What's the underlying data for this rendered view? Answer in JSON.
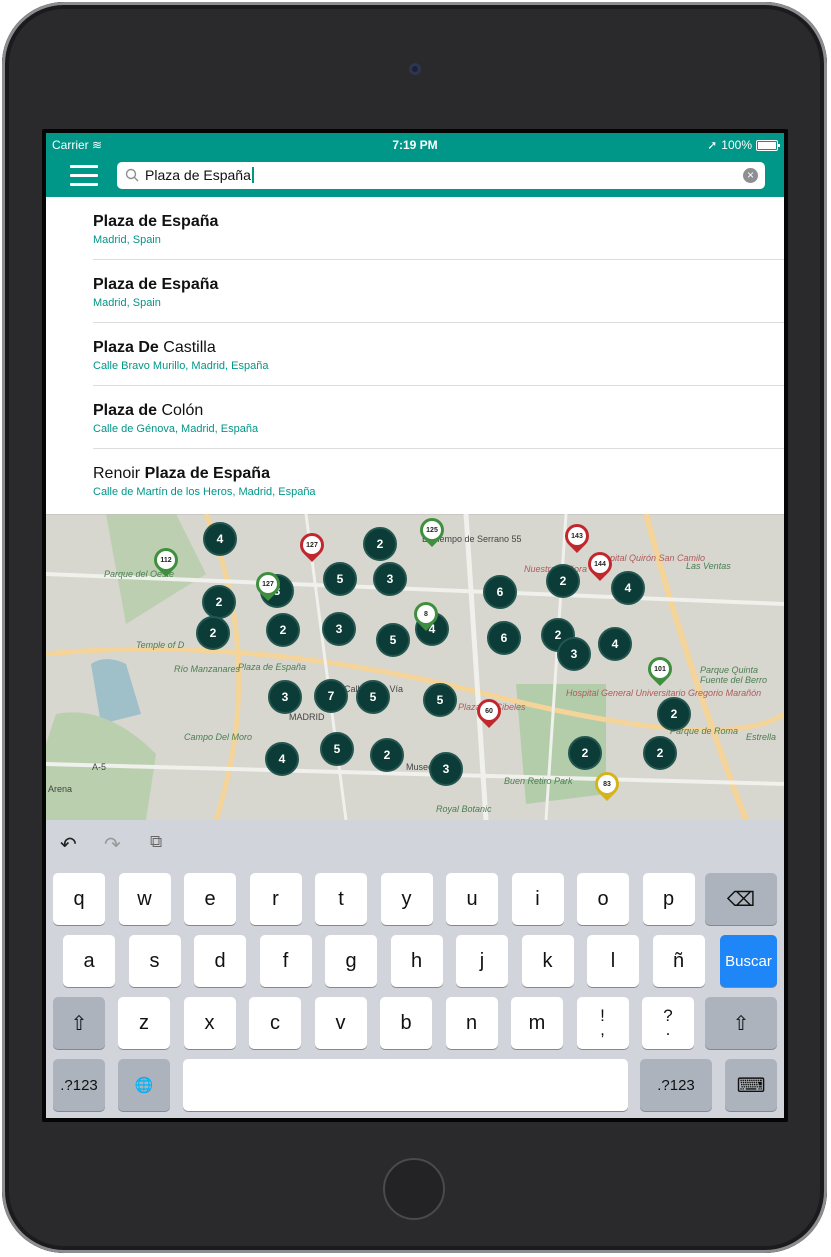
{
  "status": {
    "carrier": "Carrier",
    "time": "7:19 PM",
    "battery": "100%"
  },
  "search": {
    "query": "Plaza de España",
    "icon": "search-icon",
    "clear_icon": "clear-icon"
  },
  "results": [
    {
      "bold": "Plaza de España",
      "rest": "",
      "prefix": "",
      "subtitle": "Madrid, Spain"
    },
    {
      "bold": "Plaza de España",
      "rest": "",
      "prefix": "",
      "subtitle": "Madrid, Spain"
    },
    {
      "bold": "Plaza De",
      "rest": " Castilla",
      "prefix": "",
      "subtitle": "Calle Bravo Murillo, Madrid, España"
    },
    {
      "bold": "Plaza de",
      "rest": " Colón",
      "prefix": "",
      "subtitle": "Calle de Génova, Madrid, España"
    },
    {
      "bold": "Plaza de España",
      "rest": "",
      "prefix": "Renoir ",
      "subtitle": "Calle de Martín de los Heros, Madrid, España"
    }
  ],
  "map": {
    "labels": [
      "Parque del Oeste",
      "Temple of D",
      "Río Manzanares",
      "Plaza de España",
      "Campo Del Moro",
      "Calle Gran Vía",
      "MADRID",
      "Hospital Quirón San Camilo",
      "Nuestra Señora",
      "Las Ventas",
      "Parque Quinta Fuente del Berro",
      "Hospital General Universitario Gregorio Marañón",
      "Parque de Roma",
      "Buen Retiro Park",
      "Royal Botanic",
      "Estrella",
      "Arena",
      "A-5",
      "El Tiempo de Serrano 55",
      "Plaza de Cibeles",
      "Museo"
    ],
    "clusters": [
      "4",
      "2",
      "5",
      "3",
      "2",
      "3",
      "6",
      "2",
      "4",
      "2",
      "2",
      "3",
      "2",
      "5",
      "4",
      "6",
      "3",
      "4",
      "3",
      "7",
      "5",
      "5",
      "2",
      "4",
      "5",
      "2",
      "3",
      "2",
      "2"
    ],
    "pins": [
      {
        "label": "112",
        "color": "#3f8f3f"
      },
      {
        "label": "127",
        "color": "#c0282e"
      },
      {
        "label": "125",
        "color": "#3f8f3f"
      },
      {
        "label": "143",
        "color": "#c0282e"
      },
      {
        "label": "144",
        "color": "#c0282e"
      },
      {
        "label": "8",
        "color": "#3f8f3f"
      },
      {
        "label": "101",
        "color": "#3f8f3f"
      },
      {
        "label": "60",
        "color": "#c0282e"
      },
      {
        "label": "83",
        "color": "#d4b31c"
      },
      {
        "label": "127",
        "color": "#3f8f3f"
      }
    ]
  },
  "keyboard": {
    "row1": [
      "q",
      "w",
      "e",
      "r",
      "t",
      "y",
      "u",
      "i",
      "o",
      "p"
    ],
    "row2": [
      "a",
      "s",
      "d",
      "f",
      "g",
      "h",
      "j",
      "k",
      "l",
      "ñ"
    ],
    "row3": [
      "z",
      "x",
      "c",
      "v",
      "b",
      "n",
      "m",
      "!\n,",
      "?\n."
    ],
    "return_label": "Buscar",
    "numbers_label": ".?123"
  }
}
